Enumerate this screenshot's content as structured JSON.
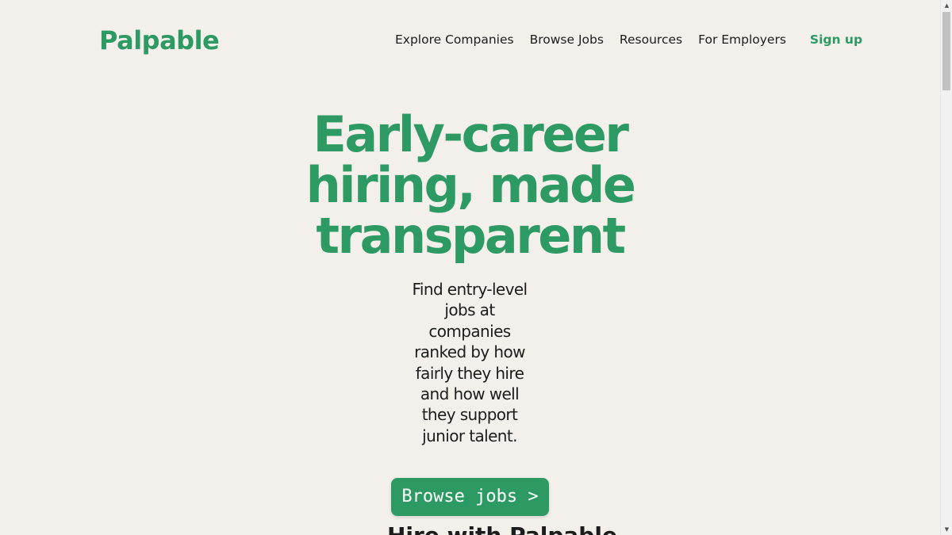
{
  "brand": {
    "logo_text": "Palpable",
    "accent_color": "#2e9a63",
    "background_color": "#f3efea"
  },
  "nav": {
    "items": [
      {
        "label": "Explore Companies"
      },
      {
        "label": "Browse Jobs"
      },
      {
        "label": "Resources"
      },
      {
        "label": "For Employers"
      }
    ],
    "signup_label": "Sign up"
  },
  "hero": {
    "title": "Early-career hiring, made transparent",
    "subtitle": "Find entry-level jobs at companies ranked by how fairly they hire and how well they support junior talent.",
    "cta_label": "Browse jobs >"
  },
  "next_section": {
    "heading": "Hire with Palpable"
  },
  "scrollbar": {
    "up_icon": "triangle-up-icon",
    "down_icon": "triangle-down-icon"
  }
}
